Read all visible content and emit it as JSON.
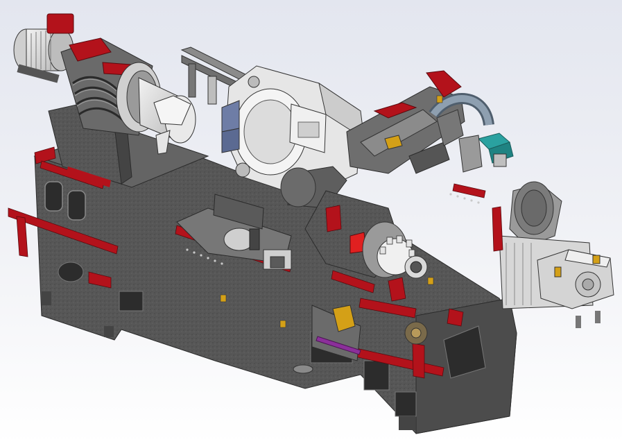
{
  "scene": {
    "subject": "",
    "colors": {
      "background_top": "#e3e6ef",
      "background_bottom": "#ffffff",
      "casting_gray": "#5a5a5a",
      "casting_dark": "#3a3a3a",
      "accent_red": "#b3121b",
      "metal_light": "#d9d9d9",
      "hose_blue": "#7f8f9f",
      "cover_blue": "#6e7da6",
      "cylinder_gray": "#6e6e6e"
    }
  }
}
